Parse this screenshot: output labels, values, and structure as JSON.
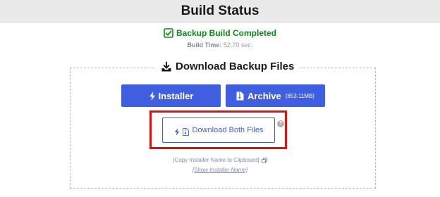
{
  "header": {
    "title": "Build Status"
  },
  "status": {
    "message": "Backup Build Completed",
    "build_time_label": "Build Time:",
    "build_time_value": "52.70 sec."
  },
  "download_panel": {
    "title": "Download Backup Files",
    "installer_label": "Installer",
    "archive_label": "Archive",
    "archive_size": "(853.11MB)",
    "download_both_label": "Download Both Files",
    "help_icon_glyph": "?",
    "copy_installer_label": "[Copy Installer Name to Clipboard]",
    "show_installer_label": "[Show Installer Name]"
  },
  "colors": {
    "primary_blue": "#3f5ee0",
    "success_green": "#0b8a17",
    "highlight_red": "#e01010",
    "header_bg": "#e9e9e9"
  },
  "icons": {
    "status": "check-square-icon",
    "panel_title": "download-tray-icon",
    "installer": "bolt-icon",
    "archive": "file-archive-icon",
    "download_both": [
      "bolt-icon",
      "file-archive-icon"
    ],
    "help": "help-circle-icon",
    "copy": "copy-icon"
  }
}
